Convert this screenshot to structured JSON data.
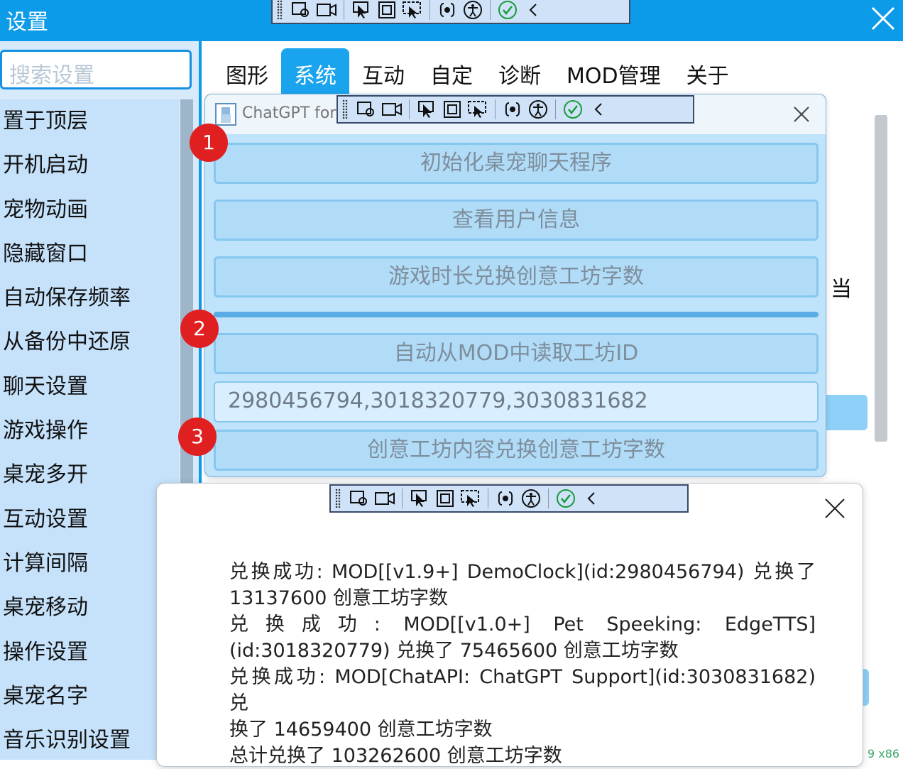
{
  "window": {
    "title": "设置"
  },
  "sidebar": {
    "search_placeholder": "搜索设置",
    "items": [
      "置于顶层",
      "开机启动",
      "宠物动画",
      "隐藏窗口",
      "自动保存频率",
      "从备份中还原",
      "聊天设置",
      "游戏操作",
      "桌宠多开",
      "互动设置",
      "计算间隔",
      "桌宠移动",
      "操作设置",
      "桌宠名字",
      "音乐识别设置"
    ]
  },
  "tabs": [
    {
      "label": "图形"
    },
    {
      "label": "系统",
      "active": true
    },
    {
      "label": "互动"
    },
    {
      "label": "自定"
    },
    {
      "label": "诊断"
    },
    {
      "label": "MOD管理"
    },
    {
      "label": "关于"
    }
  ],
  "background_peek": {
    "char": "当",
    "version": "9 x86"
  },
  "chatgpt_dialog": {
    "title": "ChatGPT for",
    "buttons": {
      "init": "初始化桌宠聊天程序",
      "user_info": "查看用户信息",
      "playtime_exchange": "游戏时长兑换创意工坊字数",
      "auto_read_id": "自动从MOD中读取工坊ID",
      "content_exchange": "创意工坊内容兑换创意工坊字数"
    },
    "workshop_ids": "2980456794,3018320779,3030831682"
  },
  "badges": [
    "1",
    "2",
    "3"
  ],
  "result_dialog": {
    "lines": [
      "兑换成功: MOD[[v1.9+] DemoClock](id:2980456794) 兑换了",
      "13137600 创意工坊字数",
      "兑换成功: MOD[[v1.0+] Pet Speeking: EdgeTTS]",
      "(id:3018320779) 兑换了 75465600 创意工坊字数",
      "兑换成功: MOD[ChatAPI: ChatGPT Support](id:3030831682) 兑",
      "换了 14659400 创意工坊字数",
      "总计兑换了 103262600 创意工坊字数"
    ]
  },
  "colors": {
    "accent": "#0b9be8",
    "badge": "#e02020",
    "toolbar_border": "#3a4a66"
  }
}
